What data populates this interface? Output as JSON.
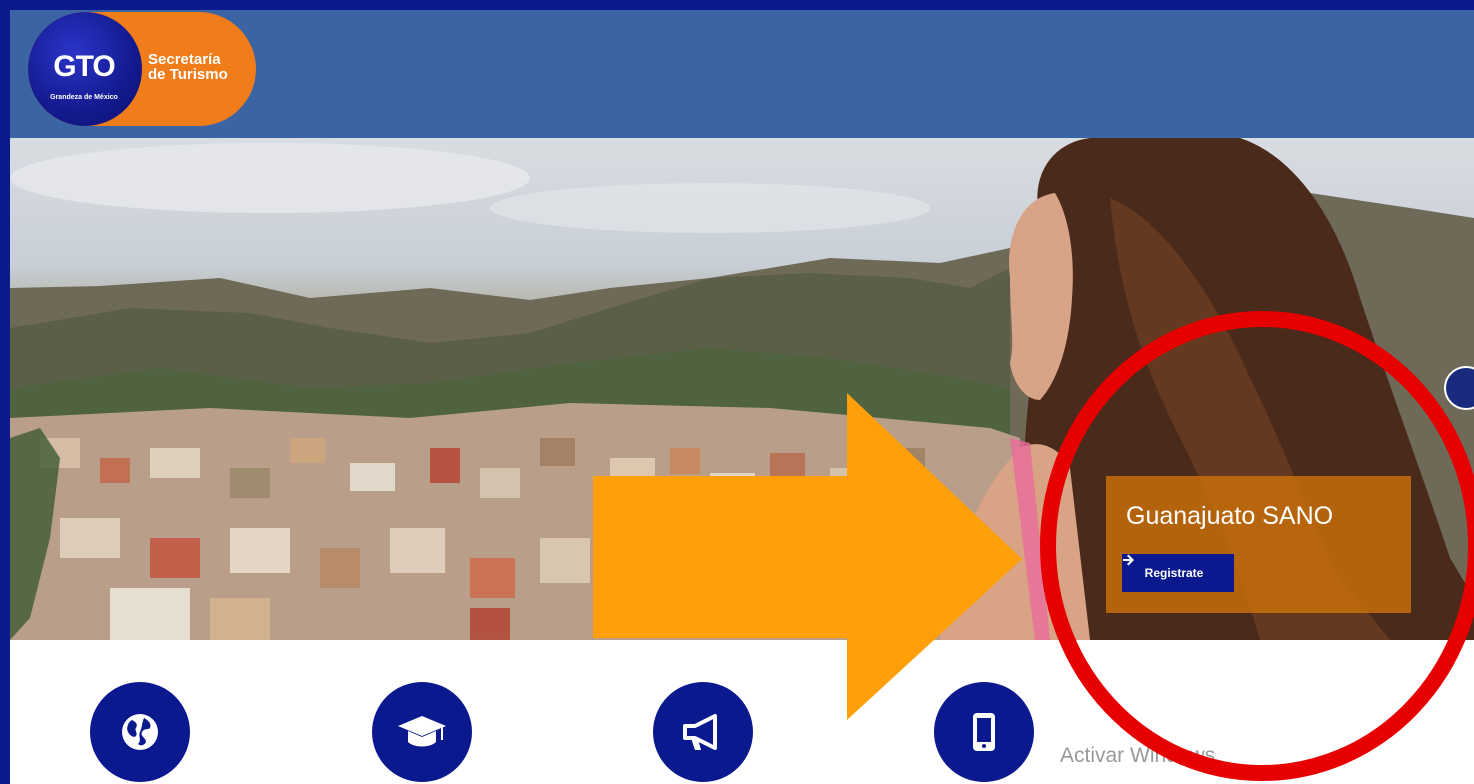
{
  "brand": {
    "logo_text": "GTO",
    "logo_subtitle": "Grandeza de México",
    "secretaria_line1": "Secretaría",
    "secretaria_line2": "de Turismo"
  },
  "hero": {
    "promo_title": "Guanajuato SANO",
    "register_label": "Registrate",
    "register_icon": "arrow-right-icon"
  },
  "features": [
    {
      "icon": "globe-icon"
    },
    {
      "icon": "graduation-cap-icon"
    },
    {
      "icon": "megaphone-icon"
    },
    {
      "icon": "mobile-phone-icon"
    }
  ],
  "watermark": "Activar Windows",
  "annotations": {
    "arrow_color": "#ff9f0a",
    "circle_color": "#e60000"
  },
  "colors": {
    "header_bg": "#3a64a3",
    "page_border": "#0b1a8c",
    "brand_orange": "#f07c1a",
    "brand_navy": "#0a1a8e"
  }
}
